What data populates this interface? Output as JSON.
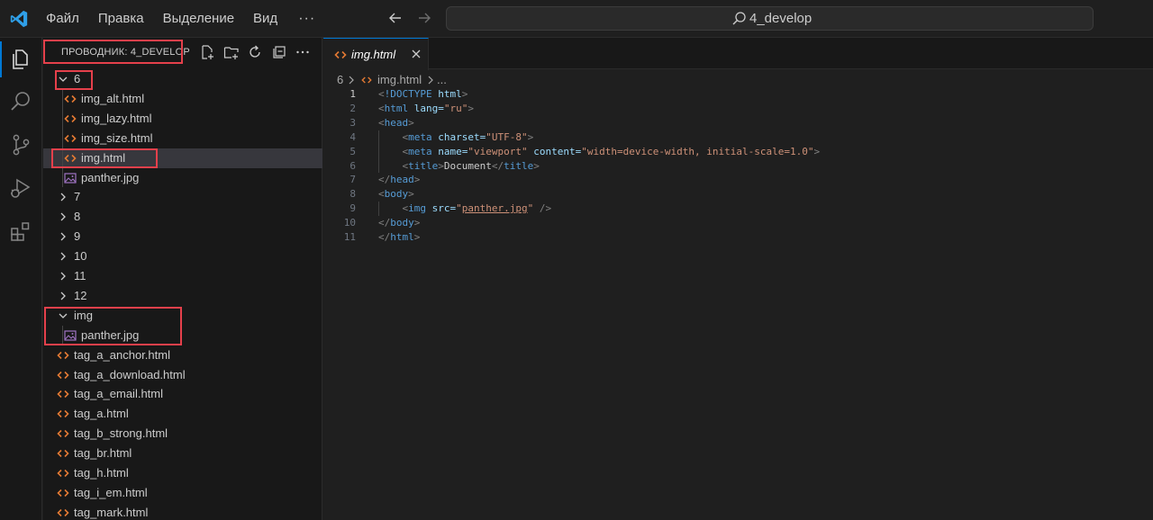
{
  "titlebar": {
    "menu": [
      "Файл",
      "Правка",
      "Выделение",
      "Вид"
    ],
    "more": "···",
    "search_text": "4_develop"
  },
  "activitybar": {
    "items": [
      "explorer-icon",
      "search-icon",
      "source-control-icon",
      "run-debug-icon",
      "extensions-icon"
    ]
  },
  "sidebar": {
    "title": "ПРОВОДНИК: 4_DEVELOP",
    "tree": [
      {
        "label": "6",
        "kind": "folder-open"
      },
      {
        "label": "img_alt.html",
        "kind": "html"
      },
      {
        "label": "img_lazy.html",
        "kind": "html"
      },
      {
        "label": "img_size.html",
        "kind": "html"
      },
      {
        "label": "img.html",
        "kind": "html",
        "selected": true
      },
      {
        "label": "panther.jpg",
        "kind": "image"
      },
      {
        "label": "7",
        "kind": "folder"
      },
      {
        "label": "8",
        "kind": "folder"
      },
      {
        "label": "9",
        "kind": "folder"
      },
      {
        "label": "10",
        "kind": "folder"
      },
      {
        "label": "11",
        "kind": "folder"
      },
      {
        "label": "12",
        "kind": "folder"
      },
      {
        "label": "img",
        "kind": "folder-open"
      },
      {
        "label": "panther.jpg",
        "kind": "image"
      },
      {
        "label": "tag_a_anchor.html",
        "kind": "html"
      },
      {
        "label": "tag_a_download.html",
        "kind": "html"
      },
      {
        "label": "tag_a_email.html",
        "kind": "html"
      },
      {
        "label": "tag_a.html",
        "kind": "html"
      },
      {
        "label": "tag_b_strong.html",
        "kind": "html"
      },
      {
        "label": "tag_br.html",
        "kind": "html"
      },
      {
        "label": "tag_h.html",
        "kind": "html"
      },
      {
        "label": "tag_i_em.html",
        "kind": "html"
      },
      {
        "label": "tag_mark.html",
        "kind": "html"
      }
    ]
  },
  "editor": {
    "tab": {
      "label": "img.html"
    },
    "breadcrumbs": {
      "folder": "6",
      "file": "img.html",
      "more": "..."
    },
    "line_numbers": [
      "1",
      "2",
      "3",
      "4",
      "5",
      "6",
      "7",
      "8",
      "9",
      "10",
      "11"
    ],
    "code": [
      {
        "t": "<!DOCTYPE html>"
      },
      {
        "t": "<html lang=\"ru\">"
      },
      {
        "t": "<head>"
      },
      {
        "t": "    <meta charset=\"UTF-8\">"
      },
      {
        "t": "    <meta name=\"viewport\" content=\"width=device-width, initial-scale=1.0\">"
      },
      {
        "t": "    <title>Document</title>"
      },
      {
        "t": "</head>"
      },
      {
        "t": "<body>"
      },
      {
        "t": "    <img src=\"panther.jpg\" />"
      },
      {
        "t": "</body>"
      },
      {
        "t": "</html>"
      }
    ]
  },
  "colors": {
    "accent": "#0078d4",
    "highlight_box": "#e5404b",
    "html_icon": "#e37933",
    "image_icon": "#a074c4"
  }
}
